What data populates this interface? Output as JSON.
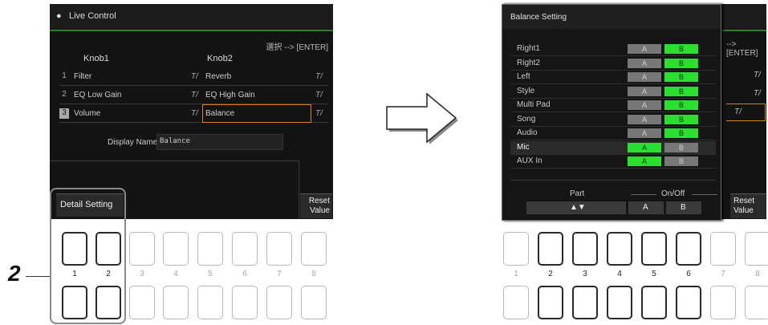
{
  "left_screen": {
    "title": "Live Control",
    "hint": "選択 --> [ENTER]",
    "col_knob1": "Knob1",
    "col_knob2": "Knob2",
    "rows": [
      {
        "num": "1",
        "knob1": "Filter",
        "knob2": "Reverb"
      },
      {
        "num": "2",
        "knob1": "EQ Low Gain",
        "knob2": "EQ High Gain"
      },
      {
        "num": "3",
        "knob1": "Volume",
        "knob2": "Balance"
      }
    ],
    "edit_glyph": "T/",
    "display_name_label": "Display Name",
    "display_name_value": "Balance",
    "detail_button": "Detail Setting",
    "reset_button_line1": "Reset",
    "reset_button_line2": "Value"
  },
  "step_number": "2",
  "right_screen": {
    "title": "Balance Setting",
    "parts": [
      {
        "label": "Right1",
        "a": "A",
        "b": "B",
        "on": "B"
      },
      {
        "label": "Right2",
        "a": "A",
        "b": "B",
        "on": "B"
      },
      {
        "label": "Left",
        "a": "A",
        "b": "B",
        "on": "B"
      },
      {
        "label": "Style",
        "a": "A",
        "b": "B",
        "on": "B"
      },
      {
        "label": "Multi Pad",
        "a": "A",
        "b": "B",
        "on": "B"
      },
      {
        "label": "Song",
        "a": "A",
        "b": "B",
        "on": "B"
      },
      {
        "label": "Audio",
        "a": "A",
        "b": "B",
        "on": "B"
      },
      {
        "label": "Mic",
        "a": "A",
        "b": "B",
        "on": "A"
      },
      {
        "label": "AUX In",
        "a": "A",
        "b": "B",
        "on": "A"
      }
    ],
    "bg_hint": "--> [ENTER]",
    "bg_reset1": "Reset",
    "bg_reset2": "Value",
    "footer_part": "Part",
    "footer_onoff": "On/Off",
    "footer_arrows": "▲▼",
    "footer_a": "A",
    "footer_b": "B"
  },
  "button_numbers": [
    "1",
    "2",
    "3",
    "4",
    "5",
    "6",
    "7",
    "8"
  ],
  "colors": {
    "on_green": "#29e02e",
    "highlight_orange": "#e07a1e",
    "title_line": "#2f7a2f"
  }
}
